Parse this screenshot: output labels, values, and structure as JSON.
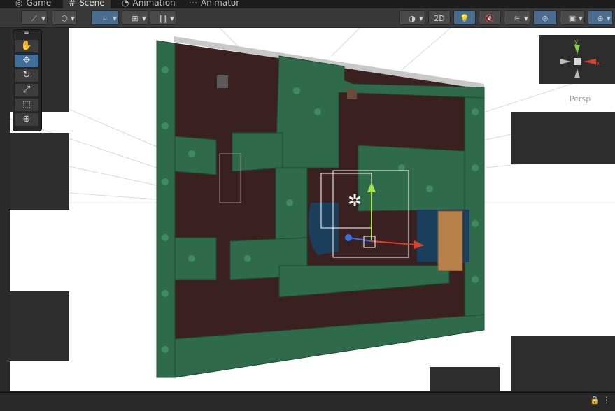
{
  "tabs": [
    {
      "label": "Game",
      "icon": "gamepad-icon"
    },
    {
      "label": "Scene",
      "icon": "grid-hash-icon"
    },
    {
      "label": "Animation",
      "icon": "clock-icon"
    },
    {
      "label": "Animator",
      "icon": "animator-icon"
    }
  ],
  "toolbar": {
    "mode_2d": "2D",
    "icons": [
      "draw-mode-icon",
      "cube-icon",
      "gizmo-move-icon",
      "grid-snap-icon",
      "ruler-icon",
      "shading-icon",
      "light-bulb-icon",
      "audio-mute-icon",
      "effects-icon",
      "hidden-eye-icon",
      "camera-icon",
      "gizmos-icon",
      "more-icon"
    ]
  },
  "tools": [
    "hand-tool-icon",
    "move-tool-icon",
    "rotate-tool-icon",
    "scale-tool-icon",
    "rect-tool-icon",
    "transform-tool-icon"
  ],
  "gizmo": {
    "x": "x",
    "y": "y",
    "projection": "Persp"
  },
  "colors": {
    "toolbar": "#393939",
    "accent": "#3d6e9e",
    "ground": "#3a2020",
    "tree": "#2f6a4b",
    "water": "#1b3f5a",
    "bridge": "#b8814a"
  }
}
